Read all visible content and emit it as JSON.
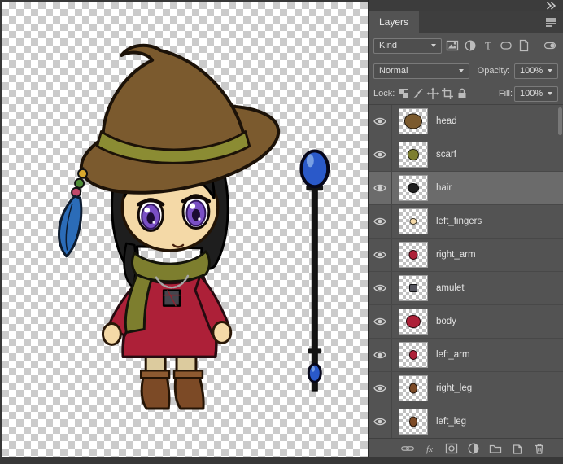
{
  "colors": {
    "panel_bg": "#535353",
    "selected_row": "#6b6b6b",
    "canvas_check_light": "#ffffff",
    "canvas_check_dark": "#cbcbcb",
    "hat": "#7b5a2e",
    "hat_band": "#8b8c33",
    "hair": "#1e1e1e",
    "skin": "#f4d9a7",
    "eye_iris": "#7a4fc5",
    "scarf": "#7d7e2e",
    "dress": "#ad2038",
    "socks": "#dccb9e",
    "boots": "#7c4a26",
    "boot_cuff": "#8d5a30",
    "staff_orb": "#2a59c9",
    "feather": "#2b6cb8"
  },
  "panel": {
    "tab_label": "Layers",
    "header_icons": [
      "collapse-to-icons-icon",
      "panel-menu-icon"
    ],
    "filter": {
      "kind_label": "Kind",
      "icons": [
        "pixel-layers-filter-icon",
        "adjustment-layers-filter-icon",
        "type-layers-filter-icon",
        "shape-layers-filter-icon",
        "smart-object-filter-icon"
      ],
      "toggle": "layer-filtering-toggle"
    },
    "blend_mode": "Normal",
    "opacity_label": "Opacity:",
    "opacity_value": "100%",
    "lock_label": "Lock:",
    "lock_icons": [
      "lock-transparent-pixels-icon",
      "lock-image-pixels-icon",
      "lock-position-icon",
      "lock-artboard-icon",
      "lock-all-icon"
    ],
    "fill_label": "Fill:",
    "fill_value": "100%",
    "layers": [
      {
        "name": "head",
        "visible": true,
        "selected": false,
        "thumb": {
          "color": "#7b5a2e",
          "w": 20,
          "h": 17,
          "shape": "blob"
        }
      },
      {
        "name": "scarf",
        "visible": true,
        "selected": false,
        "thumb": {
          "color": "#7d7e2e",
          "w": 12,
          "h": 12,
          "shape": "blob"
        }
      },
      {
        "name": "hair",
        "visible": true,
        "selected": true,
        "thumb": {
          "color": "#1e1e1e",
          "w": 12,
          "h": 10,
          "shape": "blob"
        }
      },
      {
        "name": "left_fingers",
        "visible": true,
        "selected": false,
        "thumb": {
          "color": "#f4d9a7",
          "w": 7,
          "h": 6,
          "shape": "blob"
        }
      },
      {
        "name": "right_arm",
        "visible": true,
        "selected": false,
        "thumb": {
          "color": "#ad2038",
          "w": 9,
          "h": 10,
          "shape": "blob"
        }
      },
      {
        "name": "amulet",
        "visible": true,
        "selected": false,
        "thumb": {
          "color": "#55555e",
          "w": 8,
          "h": 8,
          "shape": "square"
        }
      },
      {
        "name": "body",
        "visible": true,
        "selected": false,
        "thumb": {
          "color": "#ad2038",
          "w": 16,
          "h": 14,
          "shape": "blob"
        }
      },
      {
        "name": "left_arm",
        "visible": true,
        "selected": false,
        "thumb": {
          "color": "#ad2038",
          "w": 8,
          "h": 10,
          "shape": "blob"
        }
      },
      {
        "name": "right_leg",
        "visible": true,
        "selected": false,
        "thumb": {
          "color": "#7c4a26",
          "w": 8,
          "h": 11,
          "shape": "blob"
        }
      },
      {
        "name": "left_leg",
        "visible": true,
        "selected": false,
        "thumb": {
          "color": "#7c4a26",
          "w": 8,
          "h": 11,
          "shape": "blob"
        }
      }
    ],
    "bottom_icons": [
      "link-layers-icon",
      "layer-style-icon",
      "add-layer-mask-icon",
      "new-adjustment-layer-icon",
      "new-group-icon",
      "new-layer-icon",
      "delete-layer-icon"
    ]
  }
}
